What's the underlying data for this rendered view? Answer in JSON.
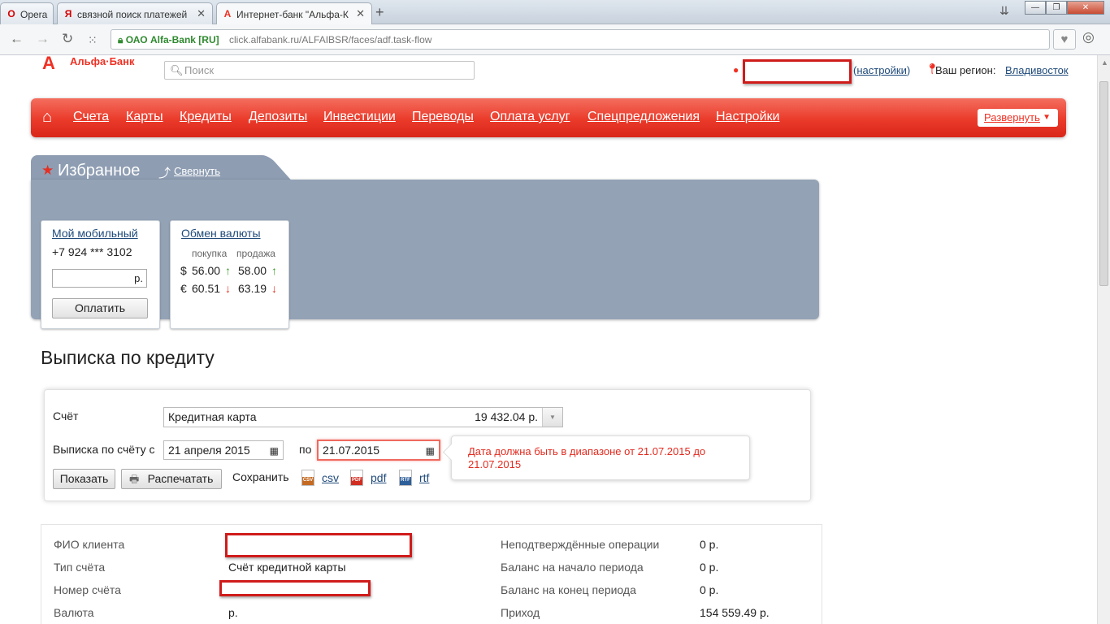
{
  "browser": {
    "tabs": [
      {
        "icon": "O",
        "title": "Opera"
      },
      {
        "icon": "Я",
        "title": "связной поиск платежей"
      },
      {
        "icon": "A",
        "title": "Интернет-банк \"Альфа-К"
      }
    ],
    "new_tab": "+",
    "secure_label": "ОАО Alfa-Bank [RU]",
    "url": "click.alfabank.ru/ALFAIBSR/faces/adf.task-flow"
  },
  "header": {
    "logo_text": "Альфа·Банк",
    "search_placeholder": "Поиск",
    "settings_link": "настройки",
    "region_label": "Ваш регион:",
    "region_value": "Владивосток"
  },
  "nav": {
    "items": [
      "Счета",
      "Карты",
      "Кредиты",
      "Депозиты",
      "Инвестиции",
      "Переводы",
      "Оплата услуг",
      "Спецпредложения",
      "Настройки"
    ],
    "expand_label": "Развернуть"
  },
  "favorites": {
    "title": "Избранное",
    "collapse_label": "Свернуть",
    "mobile": {
      "title": "Мой мобильный",
      "phone": "+7 924 *** 3102",
      "currency_suffix": "р.",
      "pay_label": "Оплатить"
    },
    "exchange": {
      "title": "Обмен валюты",
      "buy_label": "покупка",
      "sell_label": "продажа",
      "rates": [
        {
          "symbol": "$",
          "buy": "56.00",
          "buy_dir": "↑",
          "sell": "58.00",
          "sell_dir": "↑"
        },
        {
          "symbol": "€",
          "buy": "60.51",
          "buy_dir": "↓",
          "sell": "63.19",
          "sell_dir": "↓"
        }
      ]
    }
  },
  "statement": {
    "title": "Выписка по кредиту",
    "account_label": "Счёт",
    "account_name": "Кредитная карта",
    "account_balance": "19 432.04 р.",
    "period_label": "Выписка по счёту с",
    "date_from": "21 апреля 2015",
    "to_label": "по",
    "date_to": "21.07.2015",
    "error": "Дата должна быть в диапазоне от 21.07.2015 до 21.07.2015",
    "show_label": "Показать",
    "print_label": "Распечатать",
    "save_label": "Сохранить",
    "formats": [
      "csv",
      "pdf",
      "rtf"
    ]
  },
  "info": {
    "left": [
      {
        "label": "ФИО клиента",
        "value": ""
      },
      {
        "label": "Тип счёта",
        "value": "Счёт кредитной карты"
      },
      {
        "label": "Номер счёта",
        "value": ""
      },
      {
        "label": "Валюта",
        "value": "р."
      }
    ],
    "right": [
      {
        "label": "Неподтверждённые операции",
        "value": "0 р."
      },
      {
        "label": "Баланс на начало периода",
        "value": "0 р."
      },
      {
        "label": "Баланс на конец периода",
        "value": "0 р."
      },
      {
        "label": "Приход",
        "value": "154 559.49 р."
      }
    ]
  }
}
